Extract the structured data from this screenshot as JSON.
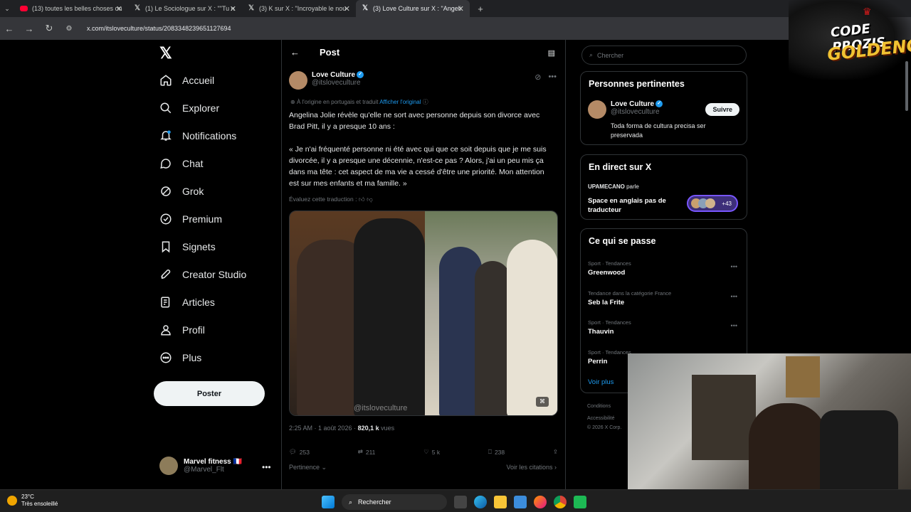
{
  "browser": {
    "tabs": [
      {
        "title": "(13) toutes les belles choses on",
        "favicon": "youtube-icon",
        "active": false
      },
      {
        "title": "(1) Le Sociologue sur X : \"\"Tu n",
        "favicon": "x-logo-icon",
        "active": false
      },
      {
        "title": "(3) K sur X : \"Incroyable le nou",
        "favicon": "x-logo-icon",
        "active": false
      },
      {
        "title": "(3) Love Culture sur X : \"Angeli",
        "favicon": "x-logo-icon",
        "active": true
      }
    ],
    "url": "x.com/itsloveculture/status/2083348239651127694"
  },
  "nav": {
    "items": [
      {
        "label": "Accueil",
        "icon": "home-icon"
      },
      {
        "label": "Explorer",
        "icon": "search-icon"
      },
      {
        "label": "Notifications",
        "icon": "bell-icon"
      },
      {
        "label": "Chat",
        "icon": "chat-icon"
      },
      {
        "label": "Grok",
        "icon": "grok-icon"
      },
      {
        "label": "Premium",
        "icon": "premium-icon"
      },
      {
        "label": "Signets",
        "icon": "bookmark-icon"
      },
      {
        "label": "Creator Studio",
        "icon": "rocket-icon"
      },
      {
        "label": "Articles",
        "icon": "article-icon"
      },
      {
        "label": "Profil",
        "icon": "profile-icon"
      },
      {
        "label": "Plus",
        "icon": "more-circle-icon"
      }
    ],
    "post_button": "Poster",
    "account": {
      "name": "Marvel fitness 🇫🇷",
      "handle": "@Marvel_Flt"
    }
  },
  "post": {
    "header": "Post",
    "author_name": "Love Culture",
    "author_handle": "@itsloveculture",
    "translation_note": "À l'origine en portugais et traduit",
    "show_original": "Afficher l'original",
    "paragraph1": "Angelina Jolie révèle qu'elle ne sort avec personne depuis son divorce avec Brad Pitt, il y a presque 10 ans :",
    "paragraph2": "« Je n'ai fréquenté personne ni été avec qui que ce soit depuis que je me suis divorcée, il y a presque une décennie, n'est-ce pas ? Alors, j'ai un peu mis ça dans ma tête : cet aspect de ma vie a cessé d'être une priorité. Mon attention est sur mes enfants et ma famille. »",
    "evaluate": "Évaluez cette traduction :",
    "image_watermark": "@itsloveculture",
    "timestamp": "2:25 AM · 1 août 2026 · ",
    "views_count": "820,1 k",
    "views_label": " vues",
    "replies": "253",
    "reposts": "211",
    "likes": "5 k",
    "bookmarks": "238",
    "sort_label": "Pertinence",
    "quotes_label": "Voir les citations"
  },
  "sidebar": {
    "search_placeholder": "Chercher",
    "relevant": {
      "title": "Personnes pertinentes",
      "name": "Love Culture",
      "handle": "@itsloveculture",
      "follow": "Suivre",
      "bio": "Toda forma de cultura precisa ser preservada"
    },
    "live": {
      "title": "En direct sur X",
      "host": "UPAMECANO",
      "host_suffix": " parle",
      "space_title": "Space en anglais pas de traducteur",
      "listeners": "+43"
    },
    "trends": {
      "title": "Ce qui se passe",
      "items": [
        {
          "category": "Sport · Tendances",
          "name": "Greenwood"
        },
        {
          "category": "Tendance dans la catégorie France",
          "name": "Seb la Frite"
        },
        {
          "category": "Sport · Tendances",
          "name": "Thauvin"
        },
        {
          "category": "Sport · Tendances",
          "name": "Perrin"
        }
      ],
      "see_more": "Voir plus"
    },
    "footer": [
      "Conditions",
      "Accessibilité",
      "© 2026 X Corp."
    ]
  },
  "overlay": {
    "logo_line1": "CODE PROZIS",
    "logo_line2": "GOLDENG"
  },
  "taskbar": {
    "temperature": "23°C",
    "weather": "Très ensoleillé",
    "search": "Rechercher"
  }
}
